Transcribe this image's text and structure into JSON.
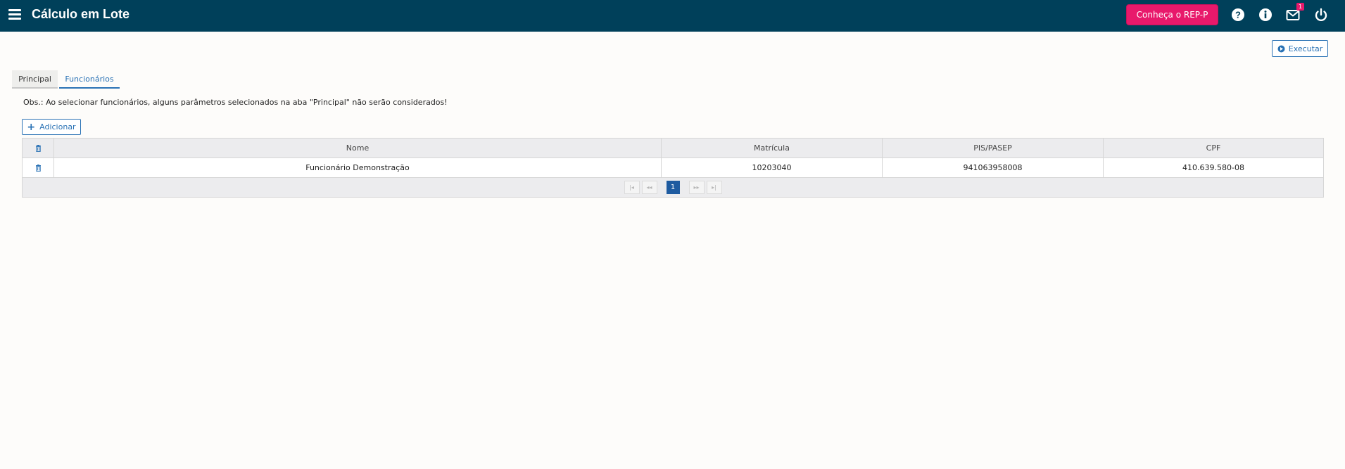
{
  "header": {
    "title": "Cálculo em Lote",
    "cta_label": "Conheça o REP-P",
    "notifications_count": "1",
    "colors": {
      "bar": "#00405a",
      "cta": "#e8196b"
    },
    "icons": [
      "menu-icon",
      "help-icon",
      "info-icon",
      "mail-icon",
      "power-icon"
    ]
  },
  "toolbar": {
    "execute_label": "Executar"
  },
  "tabs": [
    {
      "label": "Principal",
      "active": false
    },
    {
      "label": "Funcionários",
      "active": true
    }
  ],
  "notice": "Obs.: Ao selecionar funcionários, alguns parâmetros selecionados na aba \"Principal\" não serão considerados!",
  "add_label": "Adicionar",
  "table": {
    "columns": [
      "Nome",
      "Matrícula",
      "PIS/PASEP",
      "CPF"
    ],
    "rows": [
      {
        "nome": "Funcionário Demonstração",
        "matricula": "10203040",
        "pis": "941063958008",
        "cpf": "410.639.580-08"
      }
    ],
    "pager": {
      "current_page": "1"
    }
  }
}
